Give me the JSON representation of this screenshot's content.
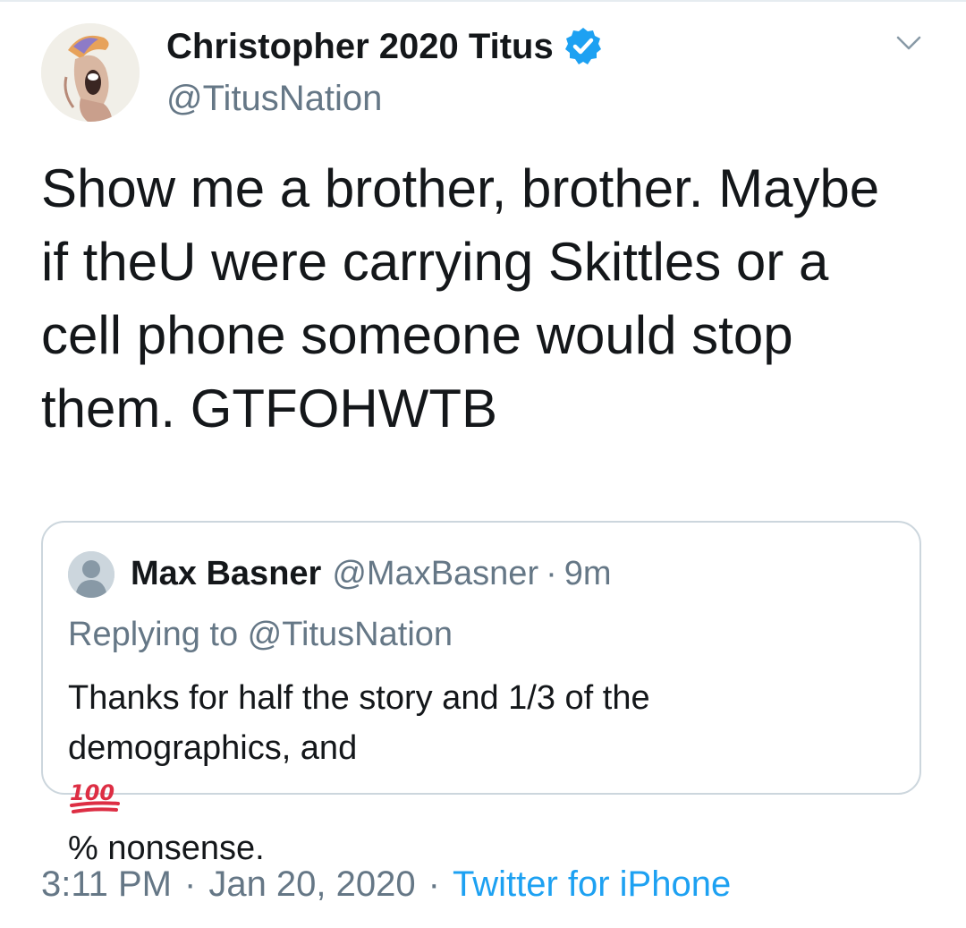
{
  "tweet": {
    "display_name": "Christopher 2020 Titus",
    "handle": "@TitusNation",
    "verified": true,
    "text_lines": [
      "Show me a brother, brother. Maybe",
      "if theU were carrying Skittles or a",
      "cell phone someone would stop",
      "them. GTFOHWTB"
    ]
  },
  "quoted_tweet": {
    "name": "Max Basner",
    "handle": "@MaxBasner",
    "separator": "·",
    "time": "9m",
    "replying_to": "Replying to @TitusNation",
    "text_line_1": "Thanks for half the story and 1/3 of the",
    "text_line_2_before": "demographics, and ",
    "emoji_name": "hundred-points-emoji",
    "text_line_2_after": "% nonsense."
  },
  "meta": {
    "time": "3:11 PM",
    "separator": "·",
    "date": "Jan 20, 2020",
    "separator2": "·",
    "source": "Twitter for iPhone"
  },
  "colors": {
    "text": "#14171a",
    "secondary": "#657786",
    "link": "#1da1f2",
    "border": "#ccd6dd",
    "verified": "#1da1f2"
  },
  "icons": [
    "verified-badge-icon",
    "chevron-down-icon",
    "default-avatar-icon"
  ]
}
